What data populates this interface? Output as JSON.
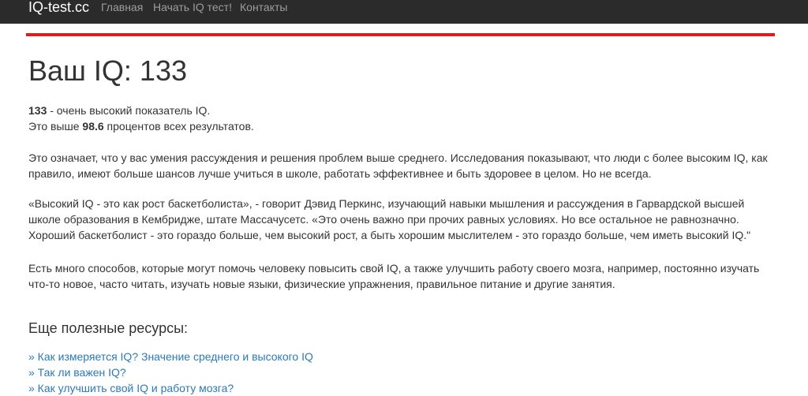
{
  "navbar": {
    "brand": "IQ-test.cc",
    "links": [
      "Главная",
      "Начать IQ тест!",
      "Контакты"
    ]
  },
  "colors": {
    "navbar_bg": "#2b2b2b",
    "accent_line": "#e21b1b",
    "link": "#2a7ab8"
  },
  "main": {
    "title": "Ваш IQ: 133",
    "summary": {
      "score": "133",
      "line1_rest": " - очень высокий показатель IQ.",
      "line2_pre": "Это выше ",
      "percent": "98.6",
      "line2_post": " процентов всех результатов."
    },
    "paragraph_explain": "Это означает, что у вас умения рассуждения и решения проблем выше среднего. Исследования показывают, что люди с более высоким IQ, как правило, имеют больше шансов лучше учиться в школе, работать эффективнее и быть здоровее в целом. Но не всегда.",
    "paragraph_quote": "«Высокий IQ - это как рост баскетболиста», - говорит Дэвид Перкинс, изучающий навыки мышления и рассуждения в Гарвардской высшей школе образования в Кембридже, штате Массачусетс. «Это очень важно при прочих равных условиях. Но все остальное не равнозначно. Хороший баскетболист - это гораздо больше, чем высокий рост, а быть хорошим мыслителем - это гораздо больше, чем иметь высокий IQ.\"",
    "paragraph_tips": "Есть много способов, которые могут помочь человеку повысить свой IQ, а также улучшить работу своего мозга, например, постоянно изучать что-то новое, часто читать, изучать новые языки, физические упражнения, правильное питание и другие занятия."
  },
  "resources": {
    "heading": "Еще полезные ресурсы:",
    "links": [
      "» Как измеряется IQ? Значение среднего и высокого IQ",
      "» Так ли важен IQ?",
      "» Как улучшить свой IQ и работу мозга?"
    ]
  }
}
